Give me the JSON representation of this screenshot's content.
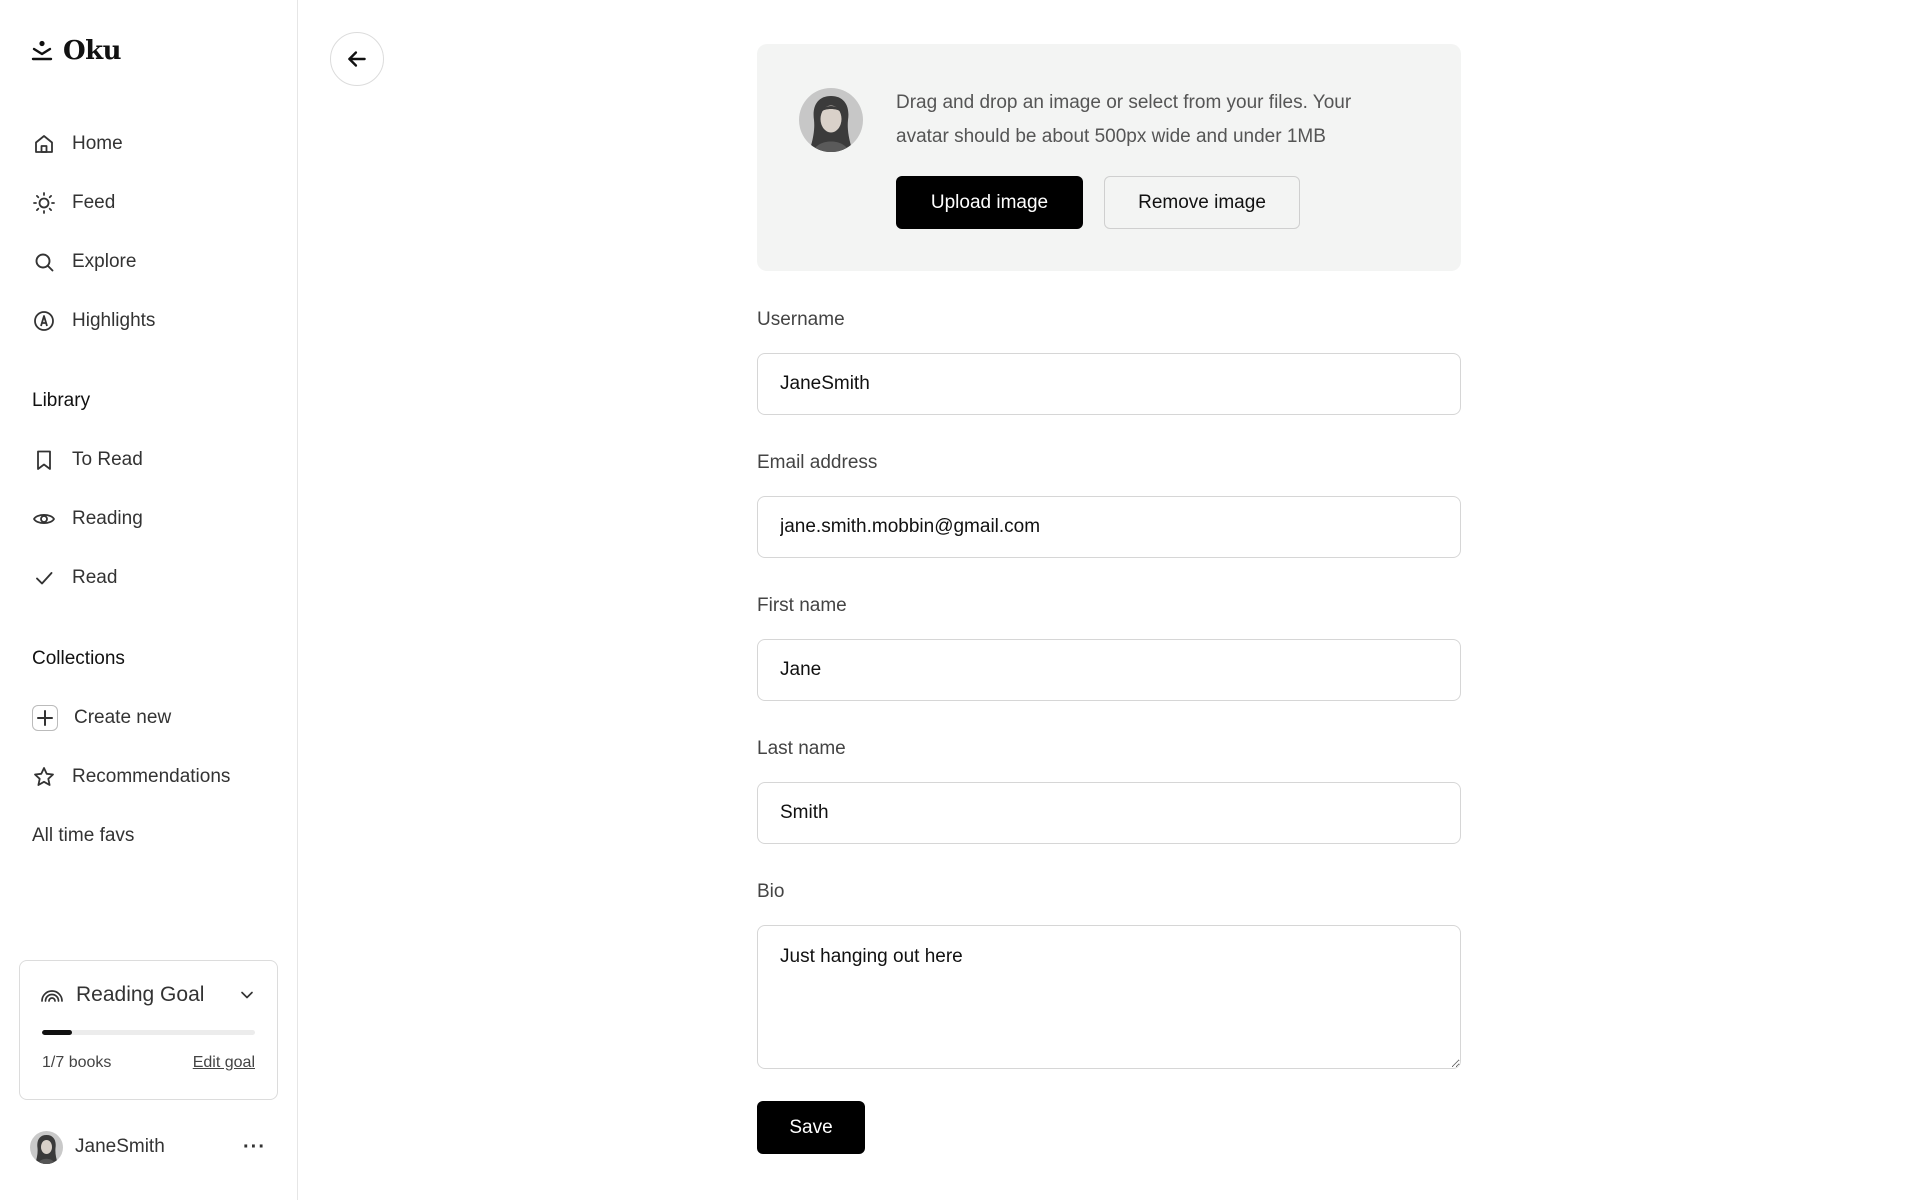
{
  "app": {
    "name": "Oku"
  },
  "sidebar": {
    "nav": [
      {
        "label": "Home",
        "icon": "home-icon"
      },
      {
        "label": "Feed",
        "icon": "sun-icon"
      },
      {
        "label": "Explore",
        "icon": "search-icon"
      },
      {
        "label": "Highlights",
        "icon": "highlight-icon"
      }
    ],
    "library": {
      "title": "Library",
      "items": [
        {
          "label": "To Read",
          "icon": "bookmark-icon"
        },
        {
          "label": "Reading",
          "icon": "eye-icon"
        },
        {
          "label": "Read",
          "icon": "check-icon"
        }
      ]
    },
    "collections": {
      "title": "Collections",
      "items": [
        {
          "label": "Create new",
          "icon": "plus-icon"
        },
        {
          "label": "Recommendations",
          "icon": "star-icon"
        },
        {
          "label": "All time favs",
          "icon": ""
        }
      ]
    },
    "reading_goal": {
      "title": "Reading Goal",
      "count": "1/7 books",
      "edit_label": "Edit goal",
      "progress": 0.143
    },
    "user": {
      "name": "JaneSmith",
      "more": "···"
    }
  },
  "profile_form": {
    "avatar_hint": "Drag and drop an image or select from your files. Your avatar should be about 500px wide and under 1MB",
    "upload_label": "Upload image",
    "remove_label": "Remove image",
    "fields": {
      "username": {
        "label": "Username",
        "value": "JaneSmith"
      },
      "email": {
        "label": "Email address",
        "value": "jane.smith.mobbin@gmail.com"
      },
      "first_name": {
        "label": "First name",
        "value": "Jane"
      },
      "last_name": {
        "label": "Last name",
        "value": "Smith"
      },
      "bio": {
        "label": "Bio",
        "value": "Just hanging out here"
      }
    },
    "save_label": "Save"
  },
  "colors": {
    "accent": "#000000",
    "panel": "#f3f4f3",
    "border": "#d6d6d6"
  }
}
